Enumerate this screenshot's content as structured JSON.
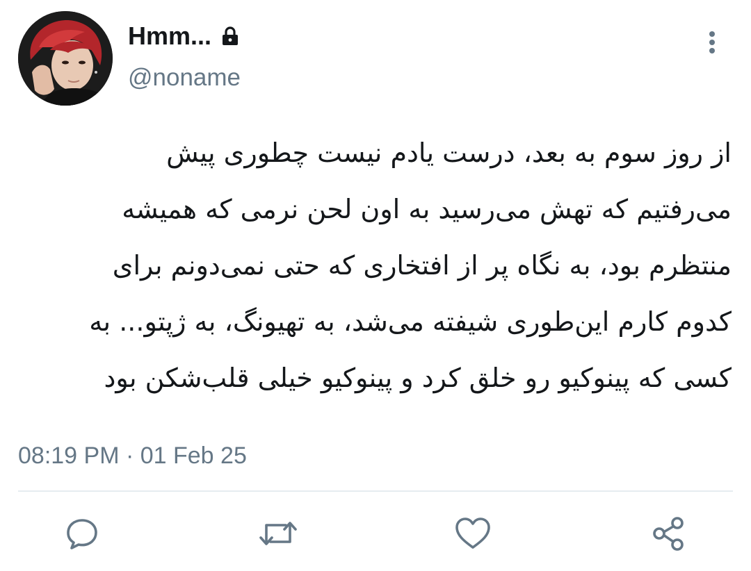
{
  "user": {
    "display_name": "Hmm...",
    "handle": "@noname",
    "protected_icon": "lock-icon",
    "avatar": "profile-photo"
  },
  "tweet": {
    "lines": [
      "از روز سوم به بعد، درست یادم نیست چطوری پیش",
      "می‌رفتیم که تهش می‌رسید به اون لحن نرمی که همیشه",
      "منتظرم بود، به نگاه پر از افتخاری که حتی نمی‌دونم برای",
      "کدوم کارم این‌طوری شیفته می‌شد، به تهیونگ، به ژپتو... به",
      "کسی که پینوکیو رو خلق کرد و پینوکیو خیلی قلب‌شکن بود"
    ],
    "timestamp": "08:19 PM · 01 Feb 25"
  },
  "actions": {
    "reply_icon": "reply-icon",
    "retweet_icon": "retweet-icon",
    "like_icon": "heart-icon",
    "share_icon": "share-icon",
    "more_icon": "more-vertical-icon"
  },
  "colors": {
    "text": "#14171a",
    "secondary": "#657786",
    "divider": "#e6ecf0"
  }
}
